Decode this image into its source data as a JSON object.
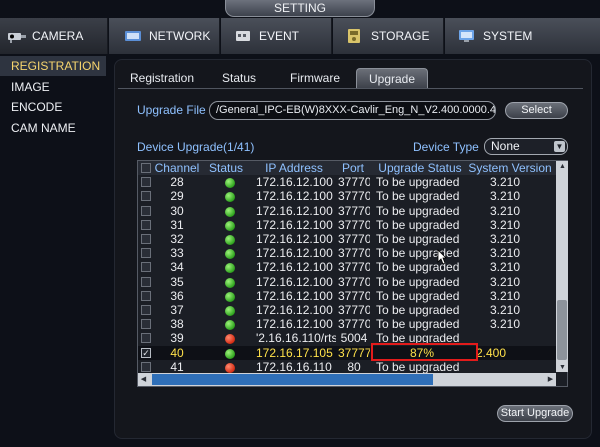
{
  "window": {
    "title": "SETTING"
  },
  "top_tabs": [
    {
      "label": "CAMERA",
      "icon": "camera-icon",
      "active": true
    },
    {
      "label": "NETWORK",
      "icon": "network-icon",
      "active": false
    },
    {
      "label": "EVENT",
      "icon": "event-icon",
      "active": false
    },
    {
      "label": "STORAGE",
      "icon": "storage-icon",
      "active": false
    },
    {
      "label": "SYSTEM",
      "icon": "system-icon",
      "active": false
    }
  ],
  "left_nav": [
    {
      "label": "REGISTRATION",
      "active": true
    },
    {
      "label": "IMAGE",
      "active": false
    },
    {
      "label": "ENCODE",
      "active": false
    },
    {
      "label": "CAM NAME",
      "active": false
    }
  ],
  "sub_tabs": [
    {
      "label": "Registration",
      "active": false
    },
    {
      "label": "Status",
      "active": false
    },
    {
      "label": "Firmware",
      "active": false
    },
    {
      "label": "Upgrade",
      "active": true
    }
  ],
  "upgrade": {
    "file_label": "Upgrade File",
    "file_value": "/General_IPC-EB(W)8XXX-Cavlir_Eng_N_V2.400.0000.4",
    "select_label": "Select",
    "device_upgrade_label": "Device Upgrade(1/41)",
    "device_type_label": "Device Type",
    "device_type_value": "None",
    "start_button": "Start Upgrade"
  },
  "table": {
    "columns": [
      "Channel",
      "Status",
      "IP Address",
      "Port",
      "Upgrade Status",
      "System Version"
    ],
    "rows": [
      {
        "checked": false,
        "channel": "28",
        "status": "green",
        "ip": "172.16.12.100",
        "port": "37770",
        "upgrade_status": "To be upgraded",
        "version": "3.210"
      },
      {
        "checked": false,
        "channel": "29",
        "status": "green",
        "ip": "172.16.12.100",
        "port": "37770",
        "upgrade_status": "To be upgraded",
        "version": "3.210"
      },
      {
        "checked": false,
        "channel": "30",
        "status": "green",
        "ip": "172.16.12.100",
        "port": "37770",
        "upgrade_status": "To be upgraded",
        "version": "3.210"
      },
      {
        "checked": false,
        "channel": "31",
        "status": "green",
        "ip": "172.16.12.100",
        "port": "37770",
        "upgrade_status": "To be upgraded",
        "version": "3.210"
      },
      {
        "checked": false,
        "channel": "32",
        "status": "green",
        "ip": "172.16.12.100",
        "port": "37770",
        "upgrade_status": "To be upgraded",
        "version": "3.210"
      },
      {
        "checked": false,
        "channel": "33",
        "status": "green",
        "ip": "172.16.12.100",
        "port": "37770",
        "upgrade_status": "To be upgraded",
        "version": "3.210"
      },
      {
        "checked": false,
        "channel": "34",
        "status": "green",
        "ip": "172.16.12.100",
        "port": "37770",
        "upgrade_status": "To be upgraded",
        "version": "3.210"
      },
      {
        "checked": false,
        "channel": "35",
        "status": "green",
        "ip": "172.16.12.100",
        "port": "37770",
        "upgrade_status": "To be upgraded",
        "version": "3.210"
      },
      {
        "checked": false,
        "channel": "36",
        "status": "green",
        "ip": "172.16.12.100",
        "port": "37770",
        "upgrade_status": "To be upgraded",
        "version": "3.210"
      },
      {
        "checked": false,
        "channel": "37",
        "status": "green",
        "ip": "172.16.12.100",
        "port": "37770",
        "upgrade_status": "To be upgraded",
        "version": "3.210"
      },
      {
        "checked": false,
        "channel": "38",
        "status": "green",
        "ip": "172.16.12.100",
        "port": "37770",
        "upgrade_status": "To be upgraded",
        "version": "3.210"
      },
      {
        "checked": false,
        "channel": "39",
        "status": "red",
        "ip": "'2.16.16.110/rtsp",
        "port": "5004",
        "upgrade_status": "To be upgraded",
        "version": ""
      },
      {
        "checked": true,
        "channel": "40",
        "status": "green",
        "ip": "172.16.17.105",
        "port": "37777",
        "upgrade_status": "87%",
        "version": "2.400"
      },
      {
        "checked": false,
        "channel": "41",
        "status": "red",
        "ip": "172.16.16.110",
        "port": "80",
        "upgrade_status": "To be upgraded",
        "version": ""
      }
    ]
  },
  "colors": {
    "accent_yellow": "#f7d56e",
    "header_blue": "#8fc1ff",
    "highlight_red": "#e31b1b",
    "status_green": "#2ea31d",
    "status_red": "#d42b12"
  }
}
